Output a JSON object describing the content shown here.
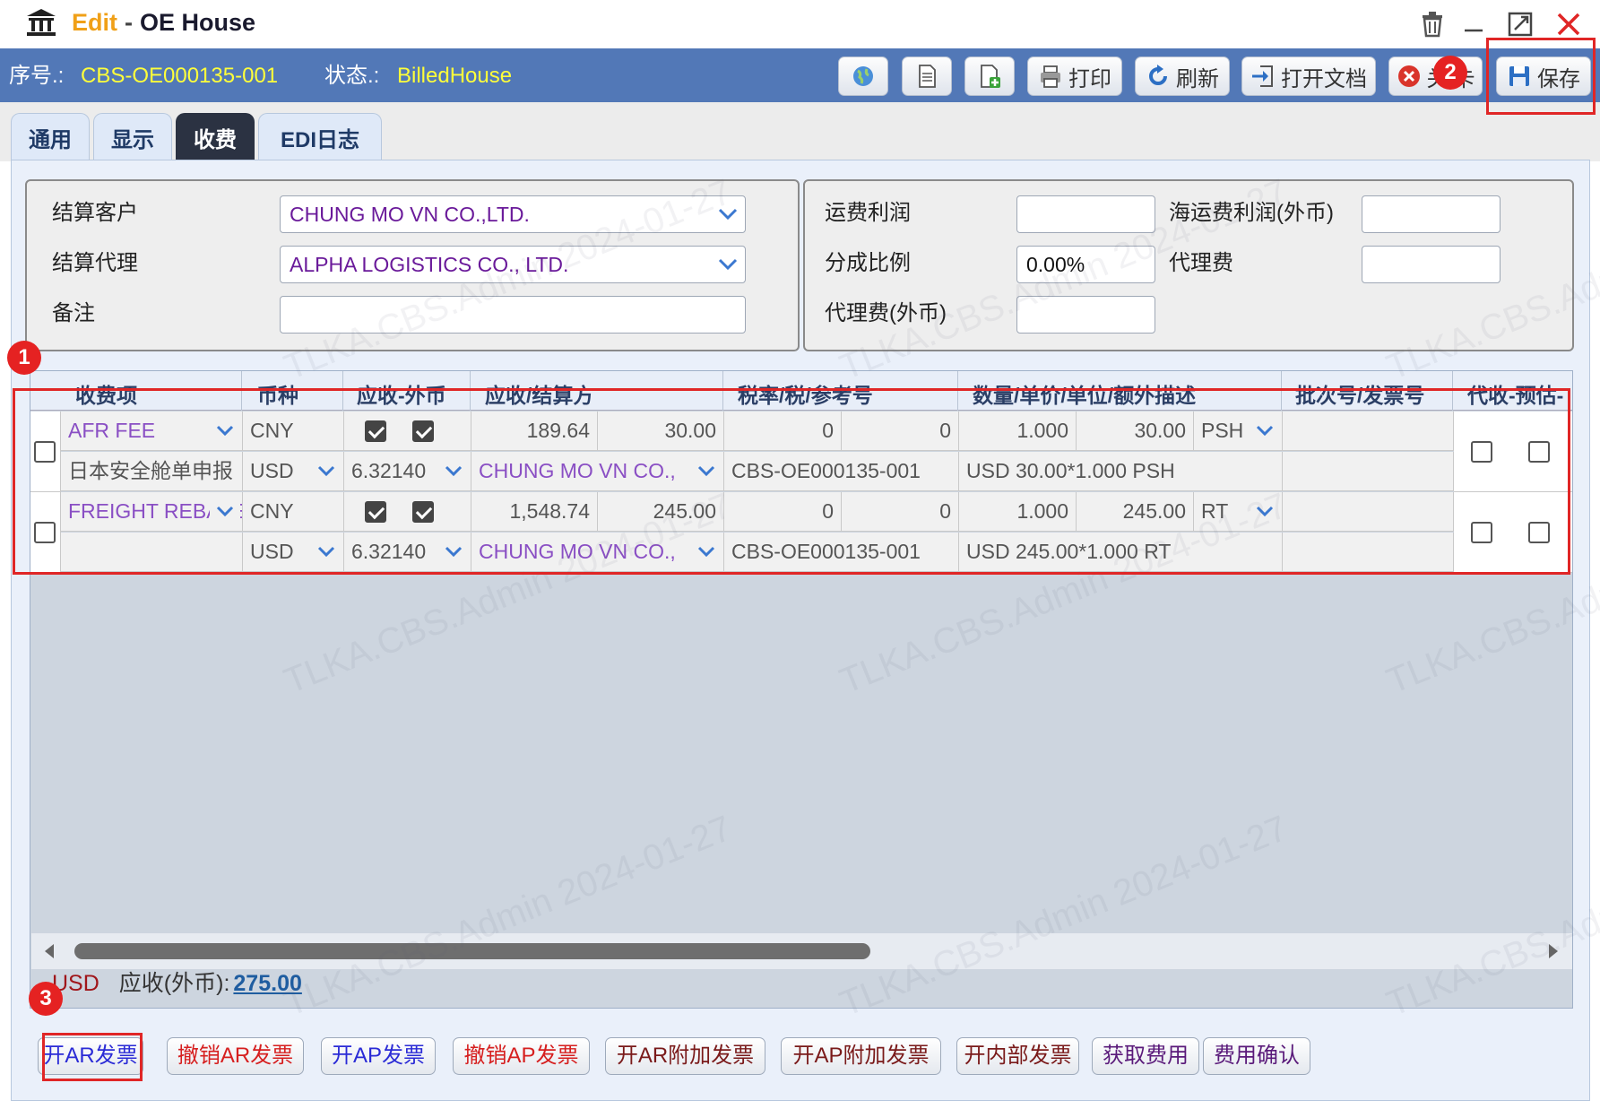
{
  "window": {
    "title_prefix": "Edit",
    "title_separator": "-",
    "title_name": "OE House",
    "icons": [
      "bank-icon",
      "trash-icon",
      "minimize-icon",
      "maximize-icon",
      "close-icon"
    ]
  },
  "header": {
    "serial_label": "序号.:",
    "serial_value": "CBS-OE000135-001",
    "status_label": "状态.:",
    "status_value": "BilledHouse",
    "buttons": {
      "print": "打印",
      "refresh": "刷新",
      "open_doc": "打开文档",
      "close_partial": "关",
      "close_tail": "卡",
      "save": "保存"
    }
  },
  "tabs": [
    "通用",
    "显示",
    "收费",
    "EDI日志"
  ],
  "active_tab": "收费",
  "form": {
    "settle_customer_label": "结算客户",
    "settle_customer_value": "CHUNG MO VN CO.,LTD.",
    "settle_agent_label": "结算代理",
    "settle_agent_value": "ALPHA LOGISTICS CO., LTD.",
    "remark_label": "备注",
    "remark_value": "",
    "freight_profit_label": "运费利润",
    "freight_profit_value": "",
    "ocean_profit_fc_label": "海运费利润(外币)",
    "ocean_profit_fc_value": "",
    "share_ratio_label": "分成比例",
    "share_ratio_value": "0.00%",
    "agent_fee_label": "代理费",
    "agent_fee_value": "",
    "agent_fee_fc_label": "代理费(外币)",
    "agent_fee_fc_value": ""
  },
  "grid": {
    "headers": [
      "收费项",
      "币种",
      "应收-外币",
      "应收/结算方",
      "税率/税/参考号",
      "数量/单价/单位/额外描述",
      "批次号/发票号",
      "代收-预估-"
    ],
    "rows": [
      {
        "charge": "AFR FEE",
        "note": "日本安全舱单申报",
        "currency1": "CNY",
        "currency2": "USD",
        "checked1": true,
        "checked2": true,
        "rate": "6.32140",
        "amount": "189.64",
        "fc_amount": "30.00",
        "party": "CHUNG MO VN CO.,",
        "tax_rate": "0",
        "tax": "0",
        "ref": "CBS-OE000135-001",
        "qty": "1.000",
        "unit_price": "30.00",
        "unit": "PSH",
        "desc": "USD 30.00*1.000 PSH",
        "batch": "",
        "collect": false,
        "estimate": false
      },
      {
        "charge": "FREIGHT REBATE",
        "note": "",
        "currency1": "CNY",
        "currency2": "USD",
        "checked1": true,
        "checked2": true,
        "rate": "6.32140",
        "amount": "1,548.74",
        "fc_amount": "245.00",
        "party": "CHUNG MO VN CO.,",
        "tax_rate": "0",
        "tax": "0",
        "ref": "CBS-OE000135-001",
        "qty": "1.000",
        "unit_price": "245.00",
        "unit": "RT",
        "desc": "USD 245.00*1.000 RT",
        "batch": "",
        "collect": false,
        "estimate": false
      }
    ]
  },
  "totals": {
    "currency": "USD",
    "label": "应收(外币):",
    "amount": "275.00"
  },
  "bottom_buttons": [
    "开AR发票",
    "撤销AR发票",
    "开AP发票",
    "撤销AP发票",
    "开AR附加发票",
    "开AP附加发票",
    "开内部发票",
    "获取费用",
    "费用确认"
  ],
  "annotations": [
    "1",
    "2",
    "3"
  ],
  "watermark": "TLKA.CBS.Admin 2024-01-27",
  "colors": {
    "header_bar": "#5278b7",
    "status_value": "#ffff3a",
    "title_edit": "#f0a018",
    "annotation_red": "#e02626",
    "party_purple": "#8a4fc4"
  }
}
